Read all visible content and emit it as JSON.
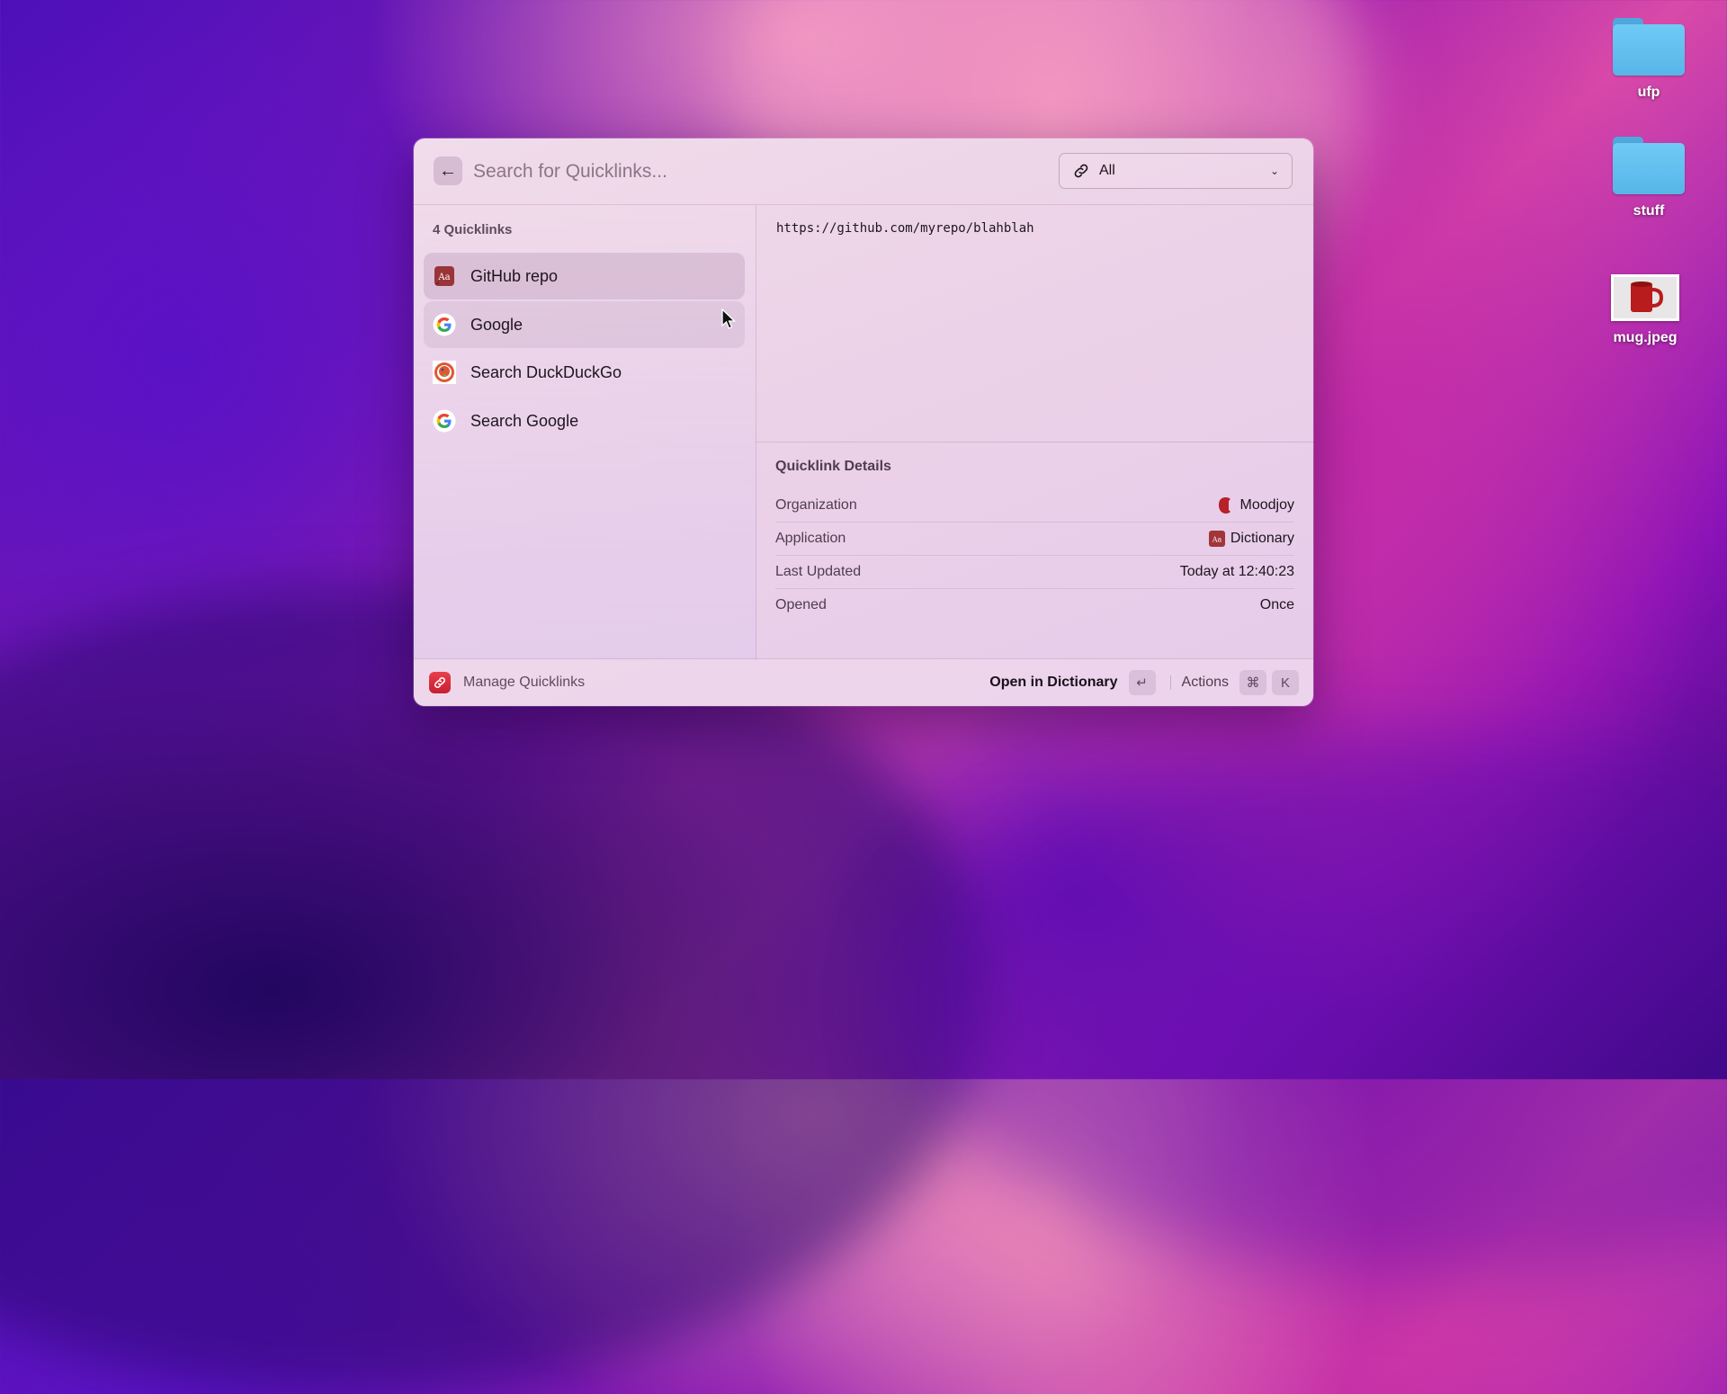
{
  "launcher": {
    "search": {
      "placeholder": "Search for Quicklinks...",
      "value": ""
    },
    "filter": {
      "selected": "All",
      "icon": "link-icon"
    },
    "list": {
      "section_title": "4 Quicklinks",
      "items": [
        {
          "label": "GitHub repo",
          "icon": "dictionary-app-icon",
          "state": "selected"
        },
        {
          "label": "Google",
          "icon": "google-icon",
          "state": "hover"
        },
        {
          "label": "Search DuckDuckGo",
          "icon": "duckduckgo-icon",
          "state": "normal"
        },
        {
          "label": "Search Google",
          "icon": "google-icon",
          "state": "normal"
        }
      ]
    },
    "detail": {
      "url": "https://github.com/myrepo/blahblah",
      "metadata_title": "Quicklink Details",
      "rows": [
        {
          "key": "Organization",
          "value": "Moodjoy",
          "icon": "moodjoy-icon"
        },
        {
          "key": "Application",
          "value": "Dictionary",
          "icon": "dictionary-app-icon"
        },
        {
          "key": "Last Updated",
          "value": "Today at 12:40:23"
        },
        {
          "key": "Opened",
          "value": "Once"
        }
      ]
    },
    "footer": {
      "app_label": "Manage Quicklinks",
      "primary_action": "Open in Dictionary",
      "primary_shortcut": "↵",
      "actions_label": "Actions",
      "actions_shortcut": [
        "⌘",
        "K"
      ]
    }
  },
  "desktop": {
    "items": [
      {
        "name": "ufp",
        "type": "folder"
      },
      {
        "name": "stuff",
        "type": "folder"
      },
      {
        "name": "mug.jpeg",
        "type": "image"
      }
    ]
  },
  "colors": {
    "accent_red": "#d42a3c",
    "folder_blue": "#62bff0"
  }
}
